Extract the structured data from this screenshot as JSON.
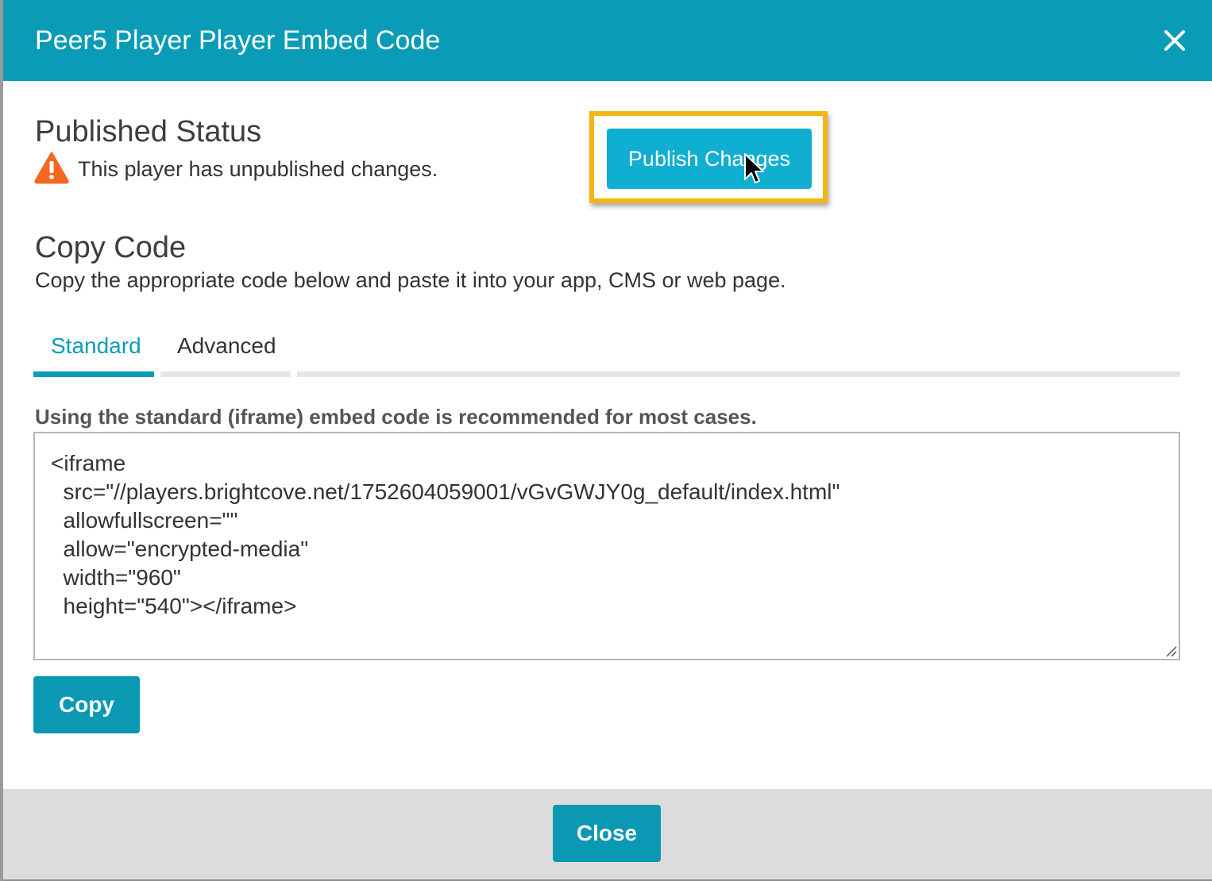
{
  "dialog": {
    "title": "Peer5 Player Player Embed Code",
    "close_icon": "close-icon"
  },
  "published_status": {
    "heading": "Published Status",
    "icon": "warning-icon",
    "icon_color": "#f26a22",
    "message": "This player has unpublished changes.",
    "publish_button": "Publish Changes",
    "highlight_color": "#f5b512"
  },
  "copy_code": {
    "heading": "Copy Code",
    "description": "Copy the appropriate code below and paste it into your app, CMS or web page.",
    "tabs": [
      {
        "label": "Standard",
        "active": true
      },
      {
        "label": "Advanced",
        "active": false
      }
    ],
    "standard_note": "Using the standard (iframe) embed code is recommended for most cases.",
    "code": "<iframe\n  src=\"//players.brightcove.net/1752604059001/vGvGWJY0g_default/index.html\"\n  allowfullscreen=\"\"\n  allow=\"encrypted-media\"\n  width=\"960\"\n  height=\"540\"></iframe>",
    "copy_button": "Copy"
  },
  "footer": {
    "close_button": "Close"
  },
  "colors": {
    "accent": "#0a9cb6",
    "button": "#0a98b3",
    "publish_button": "#10aed1",
    "footer_bg": "#dcdcdc"
  }
}
